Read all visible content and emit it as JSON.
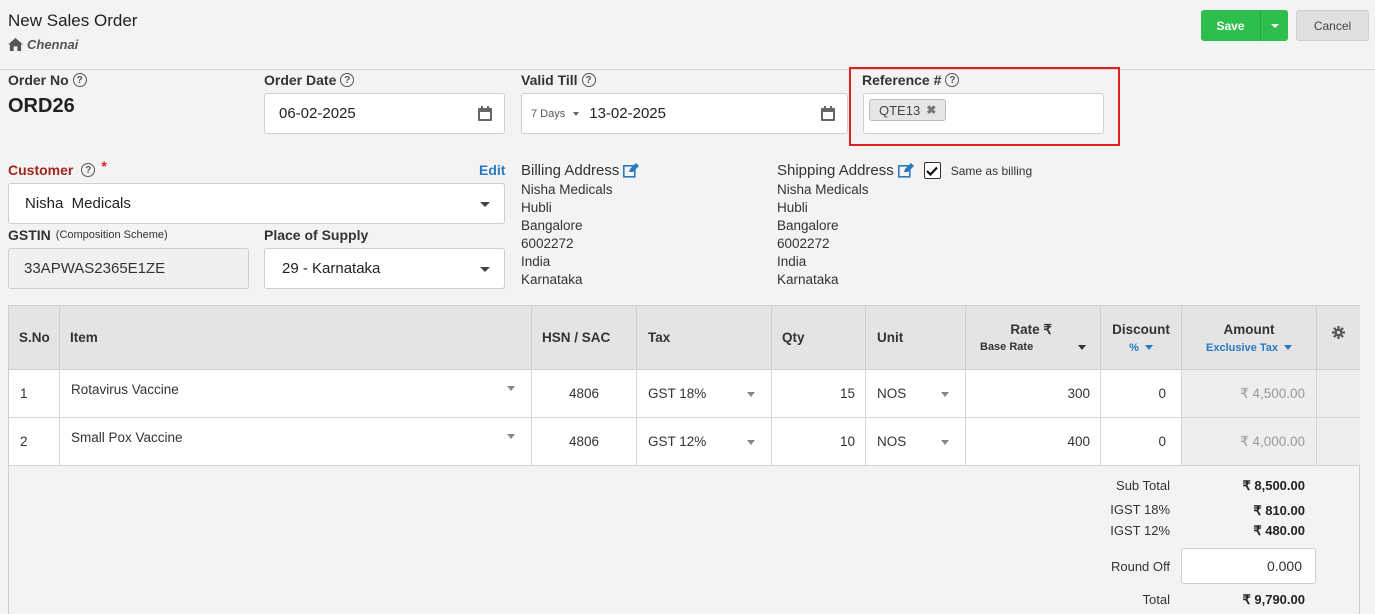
{
  "header": {
    "title": "New Sales Order",
    "branch": "Chennai",
    "save_label": "Save",
    "cancel_label": "Cancel"
  },
  "order": {
    "order_no_label": "Order No",
    "order_no": "ORD26",
    "order_date_label": "Order Date",
    "order_date": "06-02-2025",
    "valid_till_label": "Valid Till",
    "valid_days": "7 Days",
    "valid_till": "13-02-2025",
    "reference_label": "Reference #",
    "reference_tag": "QTE13"
  },
  "customer": {
    "label": "Customer",
    "required_mark": "*",
    "edit_label": "Edit",
    "name": "Nisha  Medicals",
    "gstin_label": "GSTIN",
    "gstin_scheme": "(Composition Scheme)",
    "gstin": "33APWAS2365E1ZE",
    "place_label": "Place of Supply",
    "place": "29 - Karnataka"
  },
  "billing": {
    "title": "Billing Address",
    "lines": [
      "Nisha Medicals",
      "Hubli",
      "Bangalore",
      "6002272",
      "India",
      "Karnataka"
    ]
  },
  "shipping": {
    "title": "Shipping Address",
    "same_label": "Same as billing",
    "same_checked": true,
    "lines": [
      "Nisha Medicals",
      "Hubli",
      "Bangalore",
      "6002272",
      "India",
      "Karnataka"
    ]
  },
  "table": {
    "headers": {
      "sno": "S.No",
      "item": "Item",
      "hsn": "HSN / SAC",
      "tax": "Tax",
      "qty": "Qty",
      "unit": "Unit",
      "rate": "Rate ₹",
      "rate_sub": "Base Rate",
      "discount": "Discount",
      "discount_sub": "%",
      "amount": "Amount",
      "amount_sub": "Exclusive Tax"
    },
    "rows": [
      {
        "sno": "1",
        "item": "Rotavirus Vaccine",
        "hsn": "4806",
        "tax": "GST 18%",
        "qty": "15",
        "unit": "NOS",
        "rate": "300",
        "discount": "0",
        "amount": "₹ 4,500.00"
      },
      {
        "sno": "2",
        "item": "Small Pox Vaccine",
        "hsn": "4806",
        "tax": "GST 12%",
        "qty": "10",
        "unit": "NOS",
        "rate": "400",
        "discount": "0",
        "amount": "₹ 4,000.00"
      }
    ]
  },
  "totals": {
    "subtotal_label": "Sub Total",
    "subtotal": "₹ 8,500.00",
    "igst18_label": "IGST 18%",
    "igst18": "₹ 810.00",
    "igst12_label": "IGST 12%",
    "igst12": "₹ 480.00",
    "roundoff_label": "Round Off",
    "roundoff": "0.000",
    "total_label": "Total",
    "total": "₹ 9,790.00"
  },
  "colors": {
    "save": "#2dbe4e",
    "highlight": "#e02020",
    "link": "#2a7ac0"
  }
}
